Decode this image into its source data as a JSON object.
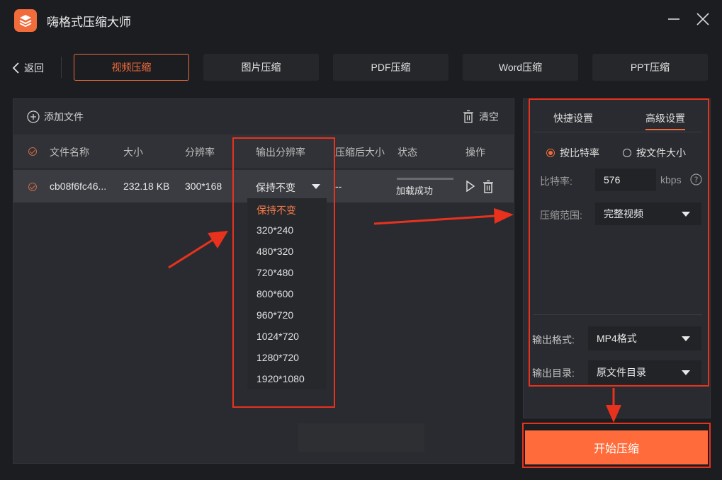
{
  "app": {
    "title": "嗨格式压缩大师"
  },
  "nav": {
    "back_label": "返回",
    "tabs": [
      "视频压缩",
      "图片压缩",
      "PDF压缩",
      "Word压缩",
      "PPT压缩"
    ],
    "active_tab": "视频压缩"
  },
  "toolbar": {
    "add_file_label": "添加文件",
    "clear_label": "清空"
  },
  "table": {
    "columns": [
      "文件名称",
      "大小",
      "分辨率",
      "输出分辨率",
      "压缩后大小",
      "状态",
      "操作"
    ],
    "rows": [
      {
        "name": "cb08f6fc46...",
        "size": "232.18 KB",
        "resolution": "300*168",
        "output_resolution": "保持不变",
        "compressed_size": "--",
        "status": "加载成功"
      }
    ]
  },
  "resolution_dropdown": {
    "selected": "保持不变",
    "options": [
      "保持不变",
      "320*240",
      "480*320",
      "720*480",
      "800*600",
      "960*720",
      "1024*720",
      "1280*720",
      "1920*1080"
    ]
  },
  "settings": {
    "tabs": [
      "快捷设置",
      "高级设置"
    ],
    "active_tab": "高级设置",
    "mode_options": [
      "按比特率",
      "按文件大小"
    ],
    "selected_mode": "按比特率",
    "bitrate_label": "比特率:",
    "bitrate_value": "576",
    "bitrate_unit": "kbps",
    "range_label": "压缩范围:",
    "range_value": "完整视频",
    "output_format_label": "输出格式:",
    "output_format_value": "MP4格式",
    "output_dir_label": "输出目录:",
    "output_dir_value": "原文件目录"
  },
  "start_button_label": "开始压缩",
  "colors": {
    "accent": "#f06a3b",
    "annotation": "#e8321e",
    "background": "#1c1d21"
  }
}
